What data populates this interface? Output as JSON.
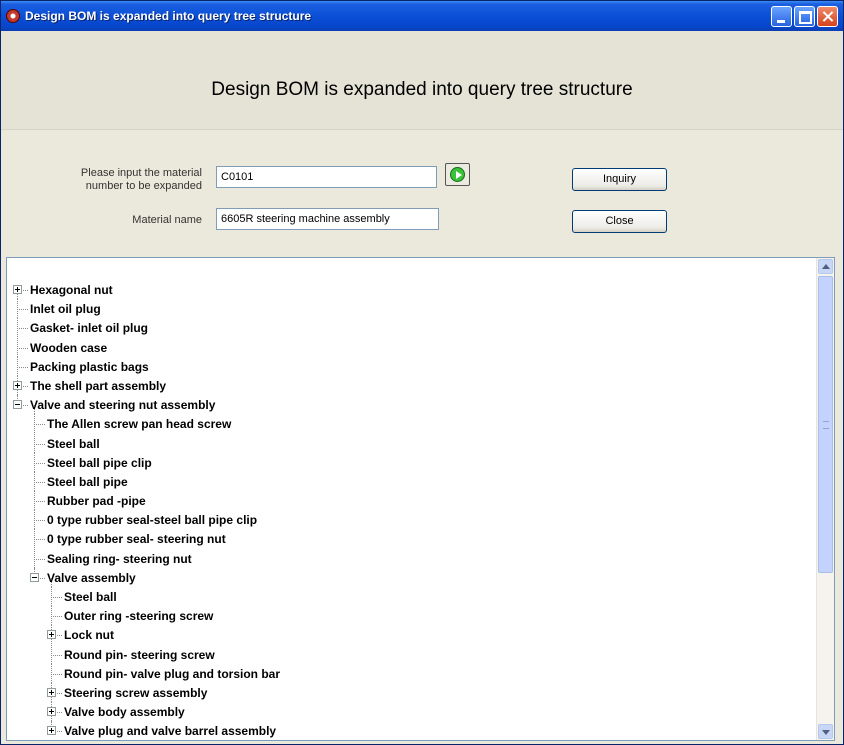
{
  "window": {
    "title": "Design BOM is expanded into query tree structure"
  },
  "header": {
    "title": "Design BOM is expanded into query tree structure"
  },
  "form": {
    "material_label": "Please input the material number to be expanded",
    "material_value": "C0101",
    "name_label": "Material name",
    "name_value": "6605R steering machine assembly"
  },
  "buttons": {
    "inquiry": "Inquiry",
    "close": "Close"
  },
  "tree": [
    {
      "label": "Hexagonal nut",
      "level": 0,
      "expander": "plus"
    },
    {
      "label": "Inlet oil plug",
      "level": 0,
      "expander": "none"
    },
    {
      "label": "Gasket- inlet oil plug",
      "level": 0,
      "expander": "none"
    },
    {
      "label": "Wooden case",
      "level": 0,
      "expander": "none"
    },
    {
      "label": "Packing plastic bags",
      "level": 0,
      "expander": "none"
    },
    {
      "label": "The shell part assembly",
      "level": 0,
      "expander": "plus"
    },
    {
      "label": "Valve and steering nut assembly",
      "level": 0,
      "expander": "minus"
    },
    {
      "label": "The Allen screw pan head screw",
      "level": 1,
      "expander": "none"
    },
    {
      "label": "Steel ball",
      "level": 1,
      "expander": "none"
    },
    {
      "label": "Steel ball pipe clip",
      "level": 1,
      "expander": "none"
    },
    {
      "label": "Steel ball pipe",
      "level": 1,
      "expander": "none"
    },
    {
      "label": "Rubber pad -pipe",
      "level": 1,
      "expander": "none"
    },
    {
      "label": "0 type rubber seal-steel ball pipe clip",
      "level": 1,
      "expander": "none"
    },
    {
      "label": "0 type rubber seal- steering nut",
      "level": 1,
      "expander": "none"
    },
    {
      "label": "Sealing ring- steering nut",
      "level": 1,
      "expander": "none"
    },
    {
      "label": "Valve assembly",
      "level": 1,
      "expander": "minus"
    },
    {
      "label": "Steel ball",
      "level": 2,
      "expander": "none"
    },
    {
      "label": "Outer ring -steering screw",
      "level": 2,
      "expander": "none"
    },
    {
      "label": "Lock nut",
      "level": 2,
      "expander": "plus"
    },
    {
      "label": "Round pin- steering screw",
      "level": 2,
      "expander": "none"
    },
    {
      "label": "Round pin- valve plug and torsion bar",
      "level": 2,
      "expander": "none"
    },
    {
      "label": "Steering screw assembly",
      "level": 2,
      "expander": "plus"
    },
    {
      "label": "Valve body assembly",
      "level": 2,
      "expander": "plus"
    },
    {
      "label": "Valve plug and valve barrel assembly",
      "level": 2,
      "expander": "plus"
    }
  ]
}
